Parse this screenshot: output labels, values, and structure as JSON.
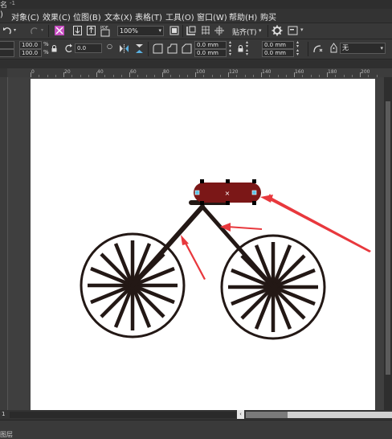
{
  "window": {
    "title_fragment": "名",
    "title_suffix": "-1"
  },
  "menu": {
    "items": [
      "对象(C)",
      "效果(C)",
      "位图(B)",
      "文本(X)",
      "表格(T)",
      "工具(O)",
      "窗口(W)",
      "帮助(H)",
      "购买"
    ],
    "first_fragment": ")"
  },
  "toolbar": {
    "zoom_value": "100%",
    "snap_label": "贴齐(T)"
  },
  "property_bar": {
    "scale_x": "100.0",
    "scale_y": "100.0",
    "percent_1": "%",
    "percent_2": "%",
    "rotation": "0.0",
    "corner_1": "0.0 mm",
    "corner_2": "0.0 mm",
    "corner_3": "0.0 mm",
    "corner_4": "0.0 mm",
    "outline_value": "无"
  },
  "ruler": {
    "ticks": [
      "0",
      "20",
      "40",
      "60",
      "80",
      "100",
      "120",
      "140",
      "160",
      "180",
      "200"
    ]
  },
  "status": {
    "page_number": "1",
    "layer_fragment": "图层"
  },
  "colors": {
    "app_bg": "#3a3a3a",
    "canvas": "#ffffff",
    "bike": "#231815",
    "seat": "#7b1717",
    "annotation_red": "#e8383d",
    "handle_cyan": "#59c2e6"
  }
}
